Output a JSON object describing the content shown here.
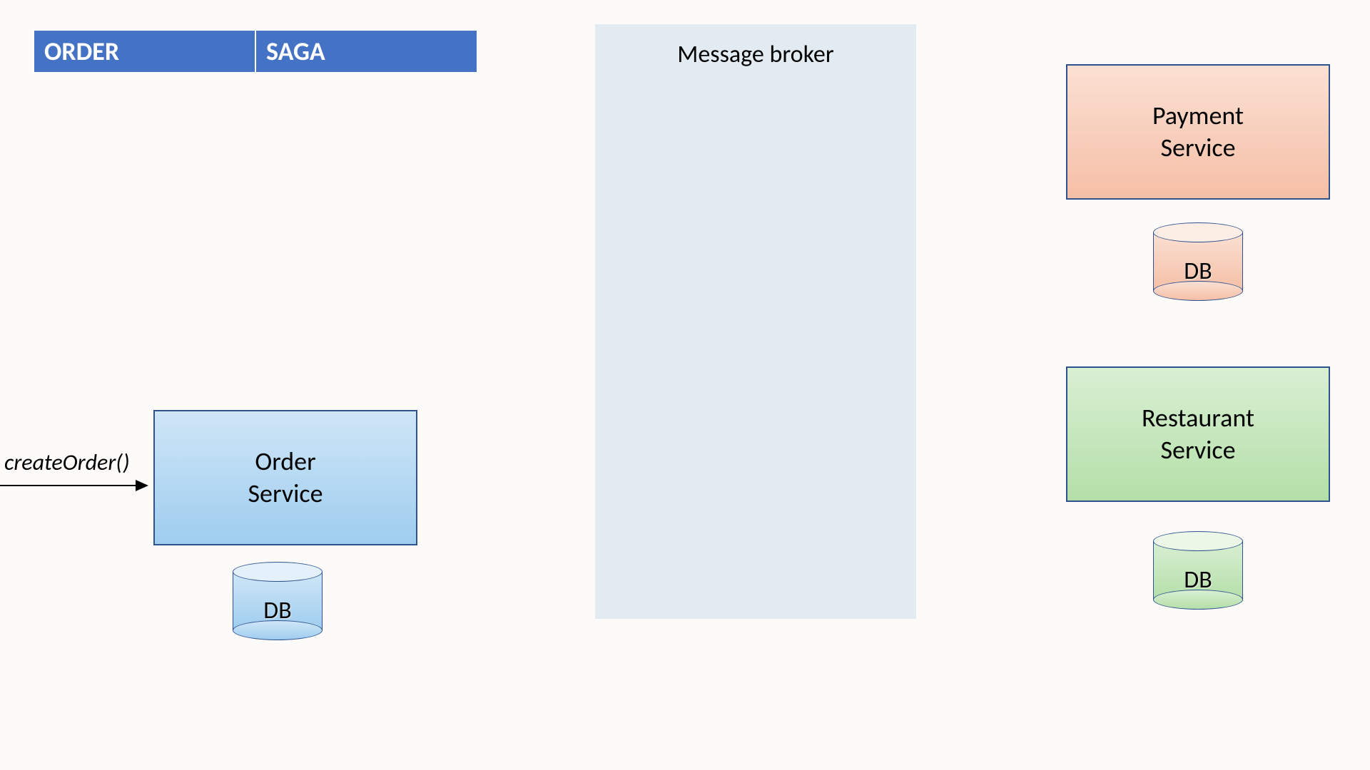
{
  "header": {
    "col1": "ORDER",
    "col2": "SAGA"
  },
  "broker": {
    "title": "Message broker"
  },
  "call": {
    "label": "createOrder()"
  },
  "services": {
    "order": {
      "name": "Order\nService",
      "db": "DB"
    },
    "payment": {
      "name": "Payment\nService",
      "db": "DB"
    },
    "restaurant": {
      "name": "Restaurant\nService",
      "db": "DB"
    }
  },
  "colors": {
    "header_bg": "#4472c4",
    "border": "#2f528f",
    "blue_fill": "#9fcdef",
    "orange_fill": "#f5bfa6",
    "green_fill": "#b4dfa8",
    "broker_fill": "#e3ebf2"
  }
}
